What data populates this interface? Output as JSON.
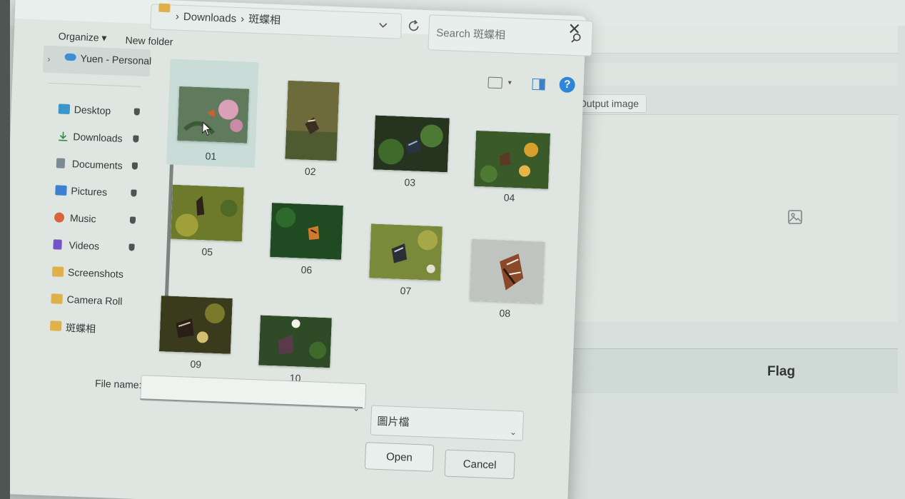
{
  "dialog": {
    "breadcrumb": [
      "Downloads",
      "斑蝶相"
    ],
    "search_placeholder": "Search 斑蝶相",
    "organize_label": "Organize ▾",
    "new_folder_label": "New folder",
    "close_glyph": "✕",
    "help_glyph": "?"
  },
  "nav": {
    "root_label": "Yuen - Personal",
    "items": [
      {
        "label": "Desktop",
        "icon": "desktop-icon",
        "pinned": true
      },
      {
        "label": "Downloads",
        "icon": "download-icon",
        "pinned": true
      },
      {
        "label": "Documents",
        "icon": "documents-icon",
        "pinned": true
      },
      {
        "label": "Pictures",
        "icon": "pictures-icon",
        "pinned": true
      },
      {
        "label": "Music",
        "icon": "music-icon",
        "pinned": true
      },
      {
        "label": "Videos",
        "icon": "videos-icon",
        "pinned": true
      },
      {
        "label": "Screenshots",
        "icon": "folder-icon",
        "pinned": false
      },
      {
        "label": "Camera Roll",
        "icon": "folder-icon",
        "pinned": false
      },
      {
        "label": "斑蝶相",
        "icon": "folder-icon",
        "pinned": false
      }
    ]
  },
  "files": [
    {
      "name": "01",
      "selected": true
    },
    {
      "name": "02",
      "selected": false
    },
    {
      "name": "03",
      "selected": false
    },
    {
      "name": "04",
      "selected": false
    },
    {
      "name": "05",
      "selected": false
    },
    {
      "name": "06",
      "selected": false
    },
    {
      "name": "07",
      "selected": false
    },
    {
      "name": "08",
      "selected": false
    },
    {
      "name": "09",
      "selected": false
    },
    {
      "name": "10",
      "selected": false
    }
  ],
  "bottom": {
    "file_name_label": "File name:",
    "file_name_value": "",
    "file_type_label": "圖片檔",
    "open_label": "Open",
    "cancel_label": "Cancel"
  },
  "background_app": {
    "output_tab_label": "Output image",
    "flag_label": "Flag"
  },
  "colors": {
    "accent": "#2f86d6",
    "folder": "#e0b04a",
    "dialog_bg": "#dfe6e2",
    "selected_tile": "#c9dcd7"
  }
}
